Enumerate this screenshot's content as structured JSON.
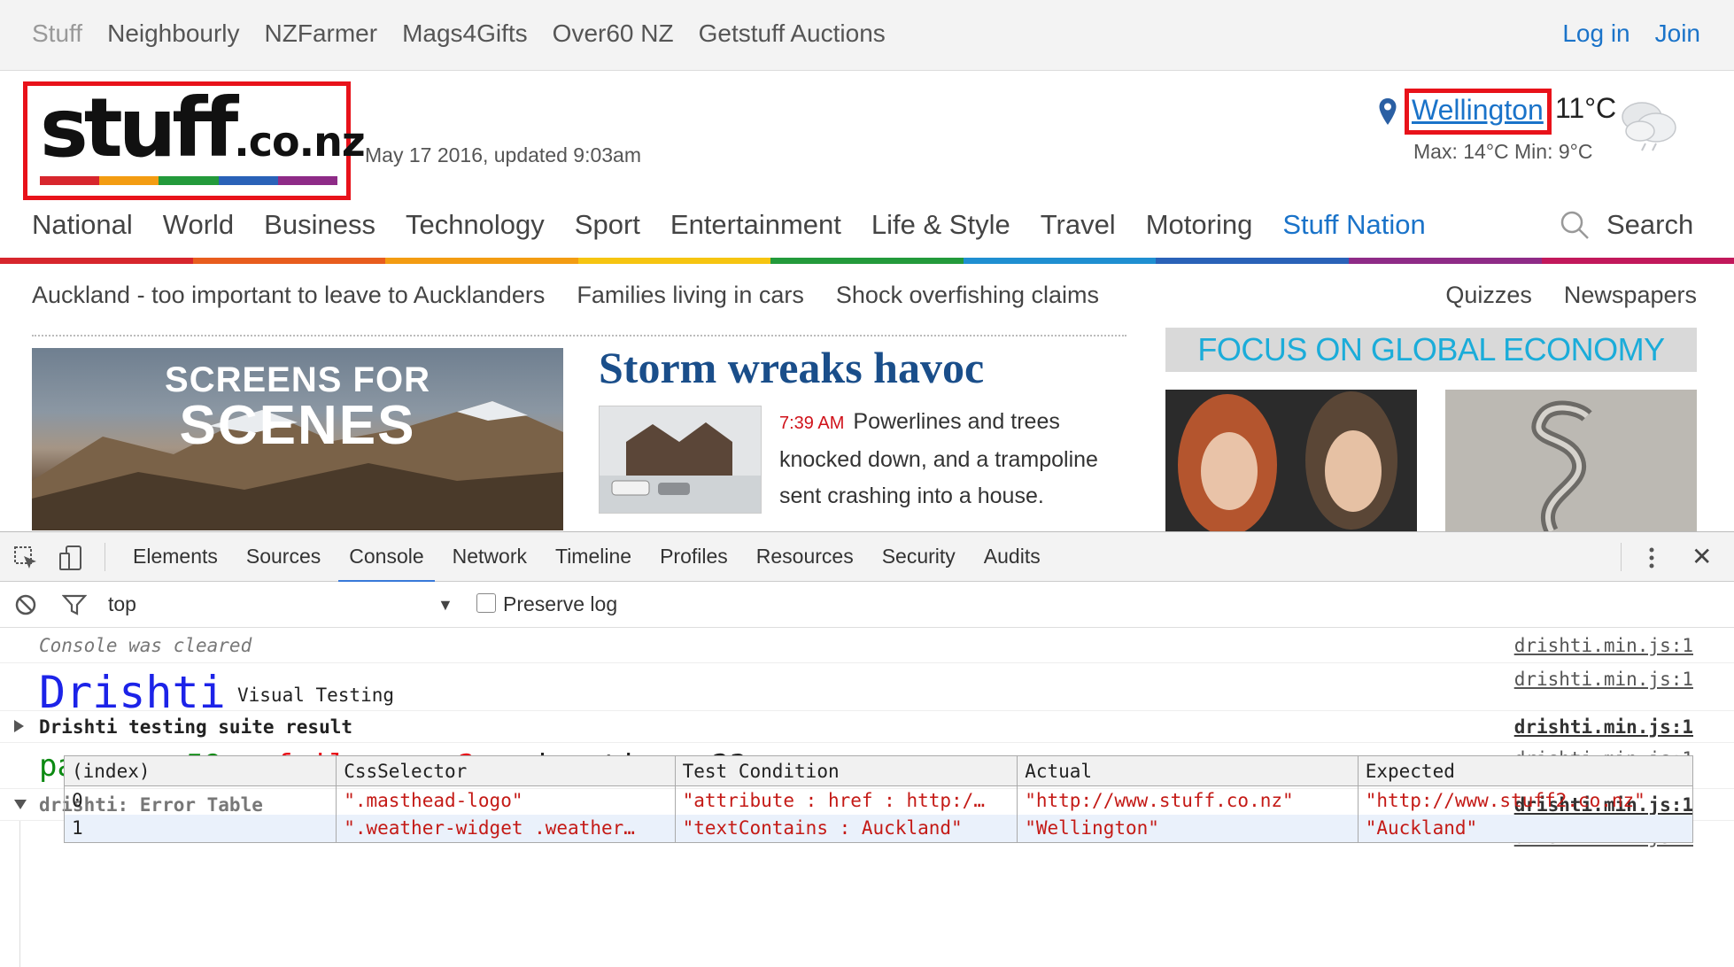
{
  "topbar": {
    "links": [
      "Stuff",
      "Neighbourly",
      "NZFarmer",
      "Mags4Gifts",
      "Over60 NZ",
      "Getstuff Auctions"
    ],
    "login": "Log in",
    "join": "Join"
  },
  "masthead": {
    "logo_main": "stuff",
    "logo_suffix": ".co.nz",
    "date": "May 17 2016, updated 9:03am",
    "stripe_colors": [
      "#d7262d",
      "#f39c12",
      "#239a3b",
      "#2a62b8",
      "#8e2b87"
    ]
  },
  "weather": {
    "city": "Wellington",
    "temp": "11°C",
    "maxmin": "Max: 14°C  Min: 9°C",
    "icon": "cloud-icon"
  },
  "nav": {
    "items": [
      "National",
      "World",
      "Business",
      "Technology",
      "Sport",
      "Entertainment",
      "Life & Style",
      "Travel",
      "Motoring",
      "Stuff Nation"
    ],
    "active_index": 9,
    "search_label": "Search"
  },
  "rainbow_colors": [
    "#d7262d",
    "#e85d1e",
    "#f39c12",
    "#f6c511",
    "#239a3b",
    "#1f8fd1",
    "#2a62b8",
    "#8e2b87",
    "#c2185b"
  ],
  "subnav": {
    "items": [
      "Auckland - too important to leave to Aucklanders",
      "Families living in cars",
      "Shock overfishing claims"
    ],
    "right": [
      "Quizzes",
      "Newspapers"
    ]
  },
  "promo": {
    "line1": "SCREENS FOR",
    "line2": "SCENES"
  },
  "story": {
    "headline": "Storm wreaks havoc",
    "time": "7:39 AM",
    "text": "Powerlines and trees knocked down, and a trampoline sent crashing into a house."
  },
  "focus": {
    "label": "FOCUS ON GLOBAL ECONOMY"
  },
  "devtools": {
    "tabs": [
      "Elements",
      "Sources",
      "Console",
      "Network",
      "Timeline",
      "Profiles",
      "Resources",
      "Security",
      "Audits"
    ],
    "active_tab": "Console",
    "context": "top",
    "preserve_log": "Preserve log",
    "preserve_log_checked": false
  },
  "console": {
    "cleared": "Console was cleared",
    "brand": "Drishti",
    "brand_sub": "Visual Testing",
    "suite_result": "Drishti testing suite result",
    "passes_label": "passes: ",
    "passes": "58",
    "sep1": " , ",
    "failures_label": "failures: ",
    "failures": "2",
    "duration_label": " , duration: ",
    "duration": "23ms",
    "error_table_label": "drishti: Error Table",
    "source": "drishti.min.js:1",
    "table": {
      "headers": [
        "(index)",
        "CssSelector",
        "Test Condition",
        "Actual",
        "Expected"
      ],
      "rows": [
        [
          "0",
          "\".masthead-logo\"",
          "\"attribute : href : http:/…",
          "\"http://www.stuff.co.nz\"",
          "\"http://www.stuff2.co.nz\""
        ],
        [
          "1",
          "\".weather-widget .weather…",
          "\"textContains : Auckland\"",
          "\"Wellington\"",
          "\"Auckland\""
        ]
      ]
    }
  }
}
